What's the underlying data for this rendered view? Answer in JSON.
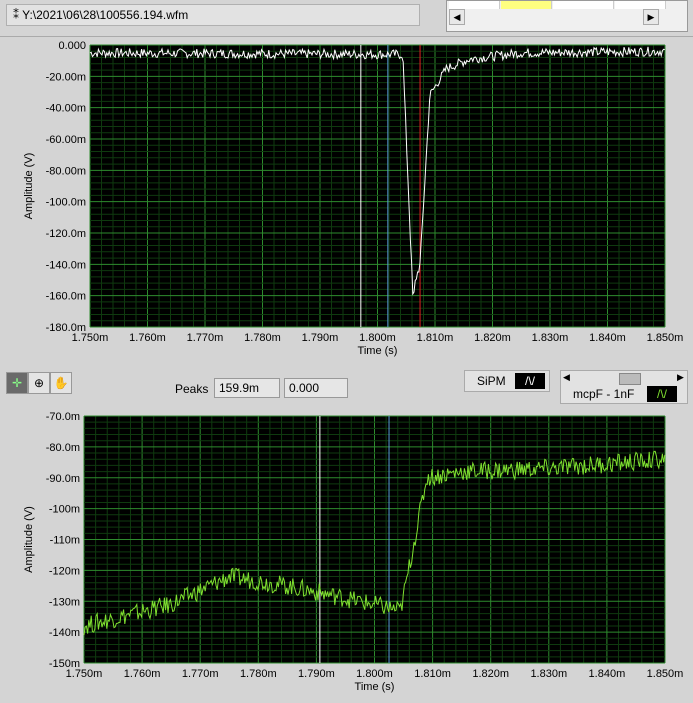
{
  "file_path": "Y:\\2021\\06\\28\\100556.194.wfm",
  "toolbar": {
    "peaks_label": "Peaks",
    "peaks_value1": "159.9m",
    "peaks_value2": "0.000",
    "legend1": "SiPM",
    "legend2": "mcpF - 1nF"
  },
  "colors": {
    "plot_bg": "#000000",
    "grid_major": "#2e8b2e",
    "grid_minor": "#0f3a0f",
    "trace1": "#ffffff",
    "trace2": "#7fe030"
  },
  "chart_data": [
    {
      "type": "line",
      "title": "",
      "xlabel": "Time (s)",
      "ylabel": "Amplitude (V)",
      "xlim": [
        1.75,
        1.85
      ],
      "ylim": [
        -180,
        0
      ],
      "xticks": [
        "1.750m",
        "1.760m",
        "1.770m",
        "1.780m",
        "1.790m",
        "1.800m",
        "1.810m",
        "1.820m",
        "1.830m",
        "1.840m",
        "1.850m"
      ],
      "yticks": [
        "0.000",
        "-20.00m",
        "-40.00m",
        "-60.00m",
        "-80.00m",
        "-100.0m",
        "-120.0m",
        "-140.0m",
        "-160.0m",
        "-180.0m"
      ],
      "series": [
        {
          "name": "SiPM",
          "x": [
            1.75,
            1.8044,
            1.8062,
            1.8066,
            1.8074,
            1.8091,
            1.812,
            1.816,
            1.825,
            1.85
          ],
          "y": [
            -5,
            -6,
            -165,
            -150,
            -140,
            -32,
            -15,
            -9,
            -5,
            -4
          ],
          "noise": 3
        }
      ],
      "cursors": [
        {
          "color": "#ffffff",
          "x": 1.7971
        },
        {
          "color": "#5a9ad8",
          "x": 1.8018
        },
        {
          "color": "#e02020",
          "x": 1.8074
        }
      ]
    },
    {
      "type": "line",
      "title": "",
      "xlabel": "Time (s)",
      "ylabel": "Amplitude (V)",
      "xlim": [
        1.75,
        1.85
      ],
      "ylim": [
        -150,
        -70
      ],
      "xticks": [
        "1.750m",
        "1.760m",
        "1.770m",
        "1.780m",
        "1.790m",
        "1.800m",
        "1.810m",
        "1.820m",
        "1.830m",
        "1.840m",
        "1.850m"
      ],
      "yticks": [
        "-70.0m",
        "-80.0m",
        "-90.0m",
        "-100m",
        "-110m",
        "-120m",
        "-130m",
        "-140m",
        "-150m"
      ],
      "series": [
        {
          "name": "mcpF - 1nF",
          "x": [
            1.75,
            1.765,
            1.775,
            1.785,
            1.795,
            1.8045,
            1.809,
            1.815,
            1.83,
            1.85
          ],
          "y": [
            -138,
            -131,
            -122,
            -125,
            -129,
            -133,
            -90,
            -88,
            -87,
            -84
          ],
          "noise": 3
        }
      ],
      "cursors": [
        {
          "color": "#ffffff",
          "x": 1.7906
        },
        {
          "color": "#5a9ad8",
          "x": 1.8025
        }
      ]
    }
  ]
}
